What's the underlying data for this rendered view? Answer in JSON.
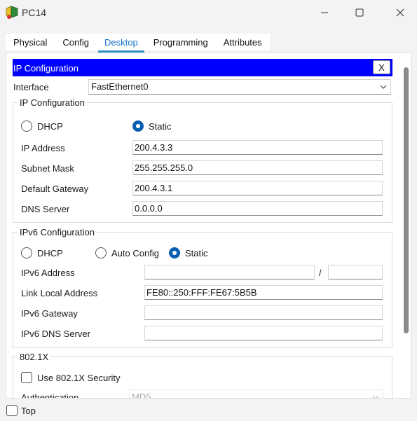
{
  "window": {
    "title": "PC14",
    "icon": "packet-tracer-pc-icon"
  },
  "tabs": [
    {
      "label": "Physical",
      "active": false
    },
    {
      "label": "Config",
      "active": false
    },
    {
      "label": "Desktop",
      "active": true
    },
    {
      "label": "Programming",
      "active": false
    },
    {
      "label": "Attributes",
      "active": false
    }
  ],
  "ip_config": {
    "header_title": "IP Configuration",
    "close_label": "X",
    "interface_label": "Interface",
    "interface_value": "FastEthernet0",
    "ipv4": {
      "group_title": "IP Configuration",
      "dhcp_label": "DHCP",
      "static_label": "Static",
      "mode": "Static",
      "ip_address_label": "IP Address",
      "ip_address": "200.4.3.3",
      "subnet_mask_label": "Subnet Mask",
      "subnet_mask": "255.255.255.0",
      "gateway_label": "Default Gateway",
      "gateway": "200.4.3.1",
      "dns_label": "DNS Server",
      "dns": "0.0.0.0"
    },
    "ipv6": {
      "group_title": "IPv6 Configuration",
      "dhcp_label": "DHCP",
      "auto_label": "Auto Config",
      "static_label": "Static",
      "mode": "Static",
      "address_label": "IPv6 Address",
      "address": "",
      "prefix_separator": "/",
      "prefix": "",
      "link_local_label": "Link Local Address",
      "link_local": "FE80::250:FFF:FE67:5B5B",
      "gateway_label": "IPv6 Gateway",
      "gateway": "",
      "dns_label": "IPv6 DNS Server",
      "dns": ""
    },
    "dot1x": {
      "group_title": "802.1X",
      "use_label": "Use 802.1X Security",
      "use_checked": false,
      "auth_label": "Authentication",
      "auth_value": "MD5"
    }
  },
  "footer": {
    "top_label": "Top",
    "top_checked": false
  }
}
